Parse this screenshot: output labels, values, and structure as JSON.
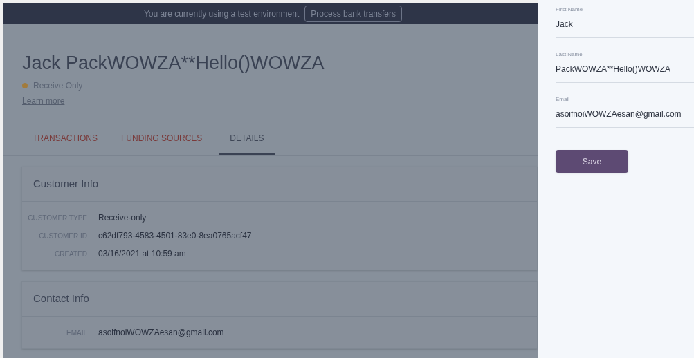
{
  "banner": {
    "message": "You are currently using a test environment",
    "button": "Process bank transfers"
  },
  "customer": {
    "name": "Jack PackWOWZA**Hello()WOWZA",
    "status": {
      "label": "Receive Only",
      "color": "#a27b3c"
    },
    "link": "Learn more"
  },
  "tabs": [
    {
      "label": "TRANSACTIONS",
      "selected": false
    },
    {
      "label": "FUNDING SOURCES",
      "selected": false
    },
    {
      "label": "DETAILS",
      "selected": true
    }
  ],
  "sections": [
    {
      "title": "Customer Info",
      "rows": [
        {
          "label": "CUSTOMER TYPE",
          "value": "Receive-only"
        },
        {
          "label": "CUSTOMER ID",
          "value": "c62df793-4583-4501-83e0-8ea0765acf47"
        },
        {
          "label": "CREATED",
          "value": "03/16/2021 at 10:59 am"
        }
      ]
    },
    {
      "title": "Contact Info",
      "rows": [
        {
          "label": "EMAIL",
          "value": "asoifnoiWOWZAesan@gmail.com"
        }
      ]
    }
  ],
  "drawer": {
    "fields": [
      {
        "label": "First Name",
        "value": "Jack"
      },
      {
        "label": "Last Name",
        "value": "PackWOWZA**Hello()WOWZA"
      },
      {
        "label": "Email",
        "value": "asoifnoiWOWZAesan@gmail.com"
      }
    ],
    "button": "Save"
  }
}
